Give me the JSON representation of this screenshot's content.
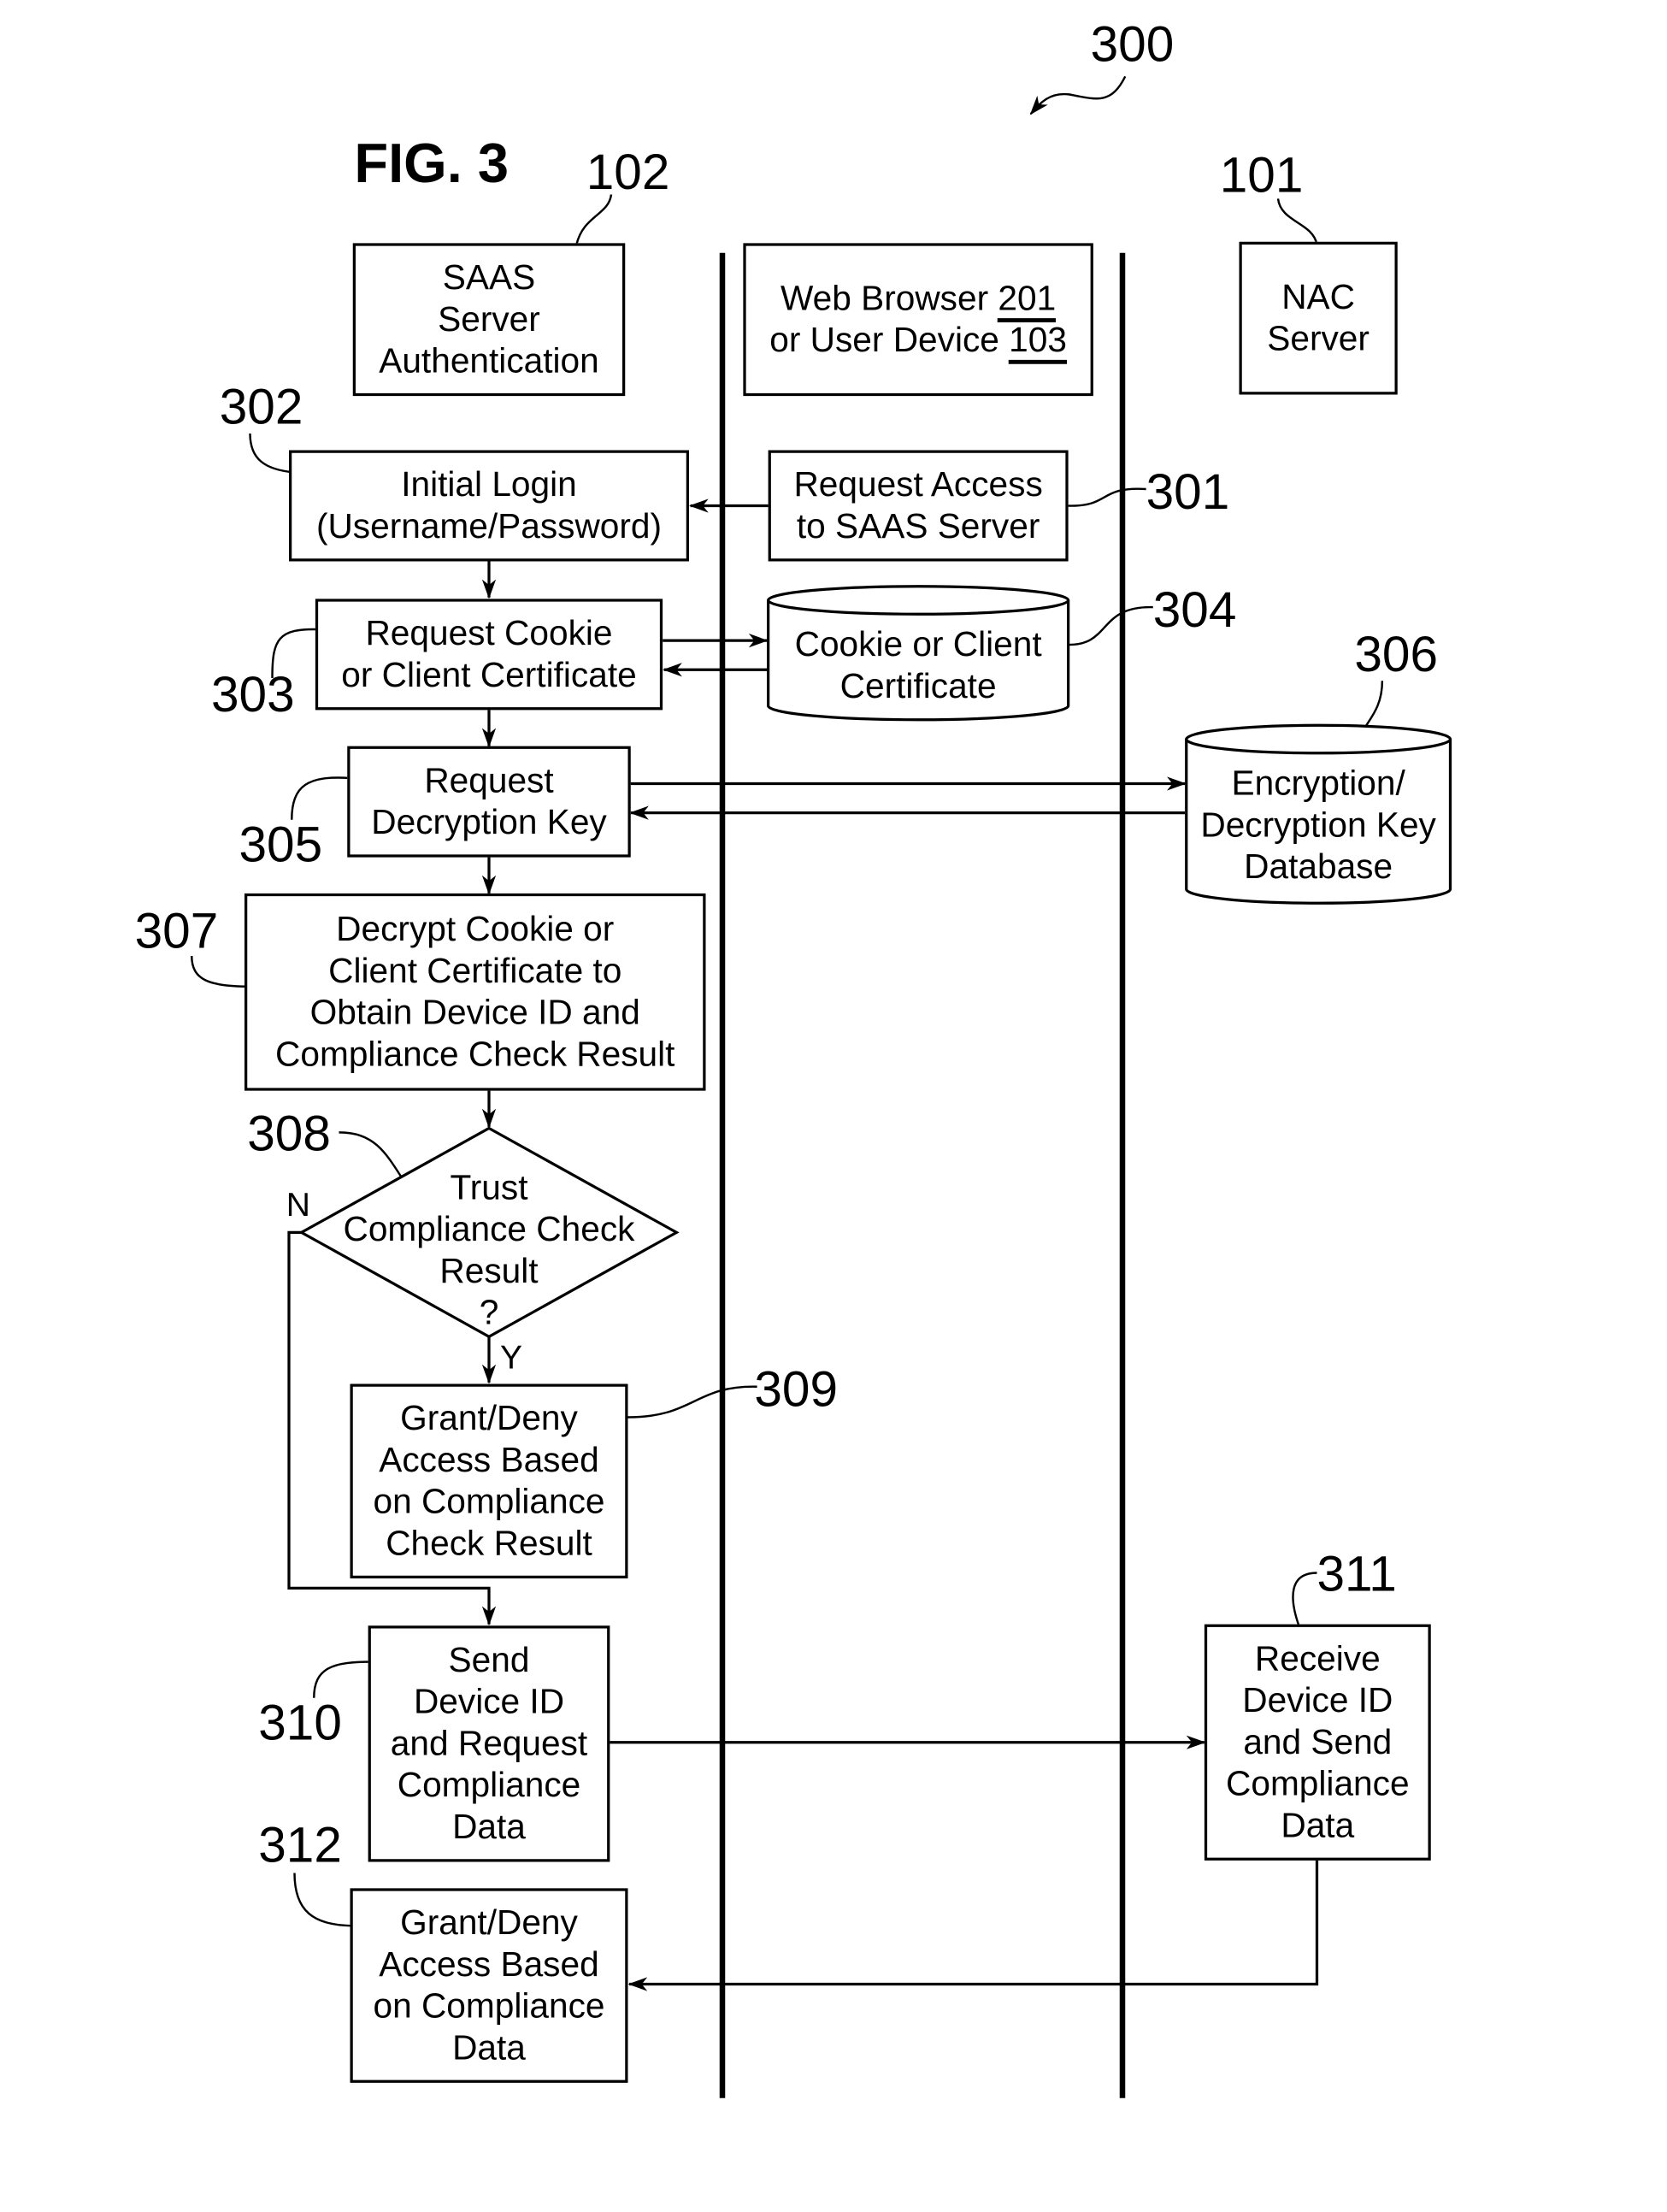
{
  "figure": {
    "title": "FIG. 3",
    "ref": "300"
  },
  "lanes": {
    "saas": {
      "ref": "102",
      "lines": [
        "SAAS",
        "Server",
        "Authentication"
      ]
    },
    "browser": {
      "line1_text": "Web Browser ",
      "line1_ref": "201",
      "line2_text": "or User Device ",
      "line2_ref": "103"
    },
    "nac": {
      "ref": "101",
      "lines": [
        "NAC",
        "Server"
      ]
    }
  },
  "steps": {
    "s301": {
      "ref": "301",
      "lines": [
        "Request Access",
        "to SAAS Server"
      ]
    },
    "s302": {
      "ref": "302",
      "lines": [
        "Initial Login",
        "(Username/Password)"
      ]
    },
    "s303": {
      "ref": "303",
      "lines": [
        "Request Cookie",
        "or Client Certificate"
      ]
    },
    "s304": {
      "ref": "304",
      "lines": [
        "Cookie or",
        "Client Certificate"
      ]
    },
    "s305": {
      "ref": "305",
      "lines": [
        "Request",
        "Decryption Key"
      ]
    },
    "s306": {
      "ref": "306",
      "lines": [
        "Encryption/",
        "Decryption",
        "Key Database"
      ]
    },
    "s307": {
      "ref": "307",
      "lines": [
        "Decrypt Cookie or",
        "Client Certificate to",
        "Obtain Device ID and",
        "Compliance Check Result"
      ]
    },
    "s308": {
      "ref": "308",
      "lines": [
        "Trust",
        "Compliance Check",
        "Result",
        "?"
      ],
      "yes": "Y",
      "no": "N"
    },
    "s309": {
      "ref": "309",
      "lines": [
        "Grant/Deny",
        "Access Based",
        "on Compliance",
        "Check Result"
      ]
    },
    "s310": {
      "ref": "310",
      "lines": [
        "Send",
        "Device ID",
        "and Request",
        "Compliance",
        "Data"
      ]
    },
    "s311": {
      "ref": "311",
      "lines": [
        "Receive",
        "Device ID",
        "and Send",
        "Compliance",
        "Data"
      ]
    },
    "s312": {
      "ref": "312",
      "lines": [
        "Grant/Deny",
        "Access Based",
        "on Compliance",
        "Data"
      ]
    }
  }
}
